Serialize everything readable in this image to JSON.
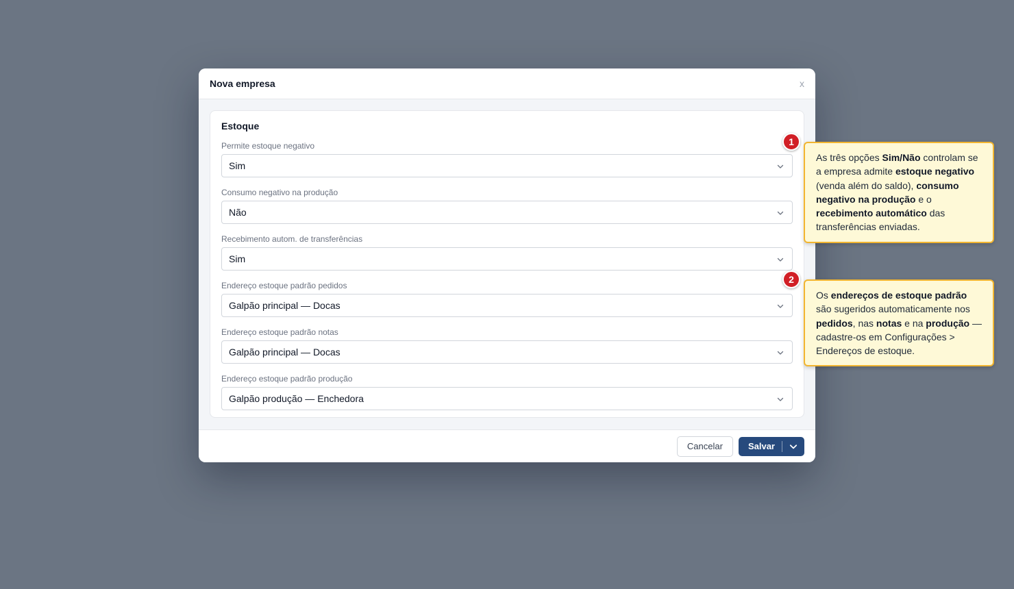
{
  "modal": {
    "title": "Nova empresa",
    "close_label": "x"
  },
  "section": {
    "title": "Estoque"
  },
  "fields": [
    {
      "label": "Permite estoque negativo",
      "value": "Sim"
    },
    {
      "label": "Consumo negativo na produção",
      "value": "Não"
    },
    {
      "label": "Recebimento autom. de transferências",
      "value": "Sim"
    },
    {
      "label": "Endereço estoque padrão pedidos",
      "value": "Galpão principal — Docas"
    },
    {
      "label": "Endereço estoque padrão notas",
      "value": "Galpão principal — Docas"
    },
    {
      "label": "Endereço estoque padrão produção",
      "value": "Galpão produção — Enchedora"
    }
  ],
  "footer": {
    "cancel_label": "Cancelar",
    "save_label": "Salvar"
  },
  "annotations": [
    {
      "number": "1",
      "parts": [
        {
          "t": "As três opções ",
          "b": false
        },
        {
          "t": "Sim/Não",
          "b": true
        },
        {
          "t": " controlam se a empresa admite ",
          "b": false
        },
        {
          "t": "estoque negativo",
          "b": true
        },
        {
          "t": " (venda além do saldo), ",
          "b": false
        },
        {
          "t": "consumo negativo na produção",
          "b": true
        },
        {
          "t": " e o ",
          "b": false
        },
        {
          "t": "recebimento automático",
          "b": true
        },
        {
          "t": " das transferências enviadas.",
          "b": false
        }
      ]
    },
    {
      "number": "2",
      "parts": [
        {
          "t": "Os ",
          "b": false
        },
        {
          "t": "endereços de estoque padrão",
          "b": true
        },
        {
          "t": " são sugeridos automaticamente nos ",
          "b": false
        },
        {
          "t": "pedidos",
          "b": true
        },
        {
          "t": ", nas ",
          "b": false
        },
        {
          "t": "notas",
          "b": true
        },
        {
          "t": " e na ",
          "b": false
        },
        {
          "t": "produção",
          "b": true
        },
        {
          "t": " — cadastre-os em Configurações > Endereços de estoque.",
          "b": false
        }
      ]
    }
  ],
  "colors": {
    "backdrop": "#6b7583",
    "primary_button": "#274a7d",
    "badge": "#d11f26",
    "callout_bg": "#fef9d7",
    "callout_border": "#f2b530"
  }
}
